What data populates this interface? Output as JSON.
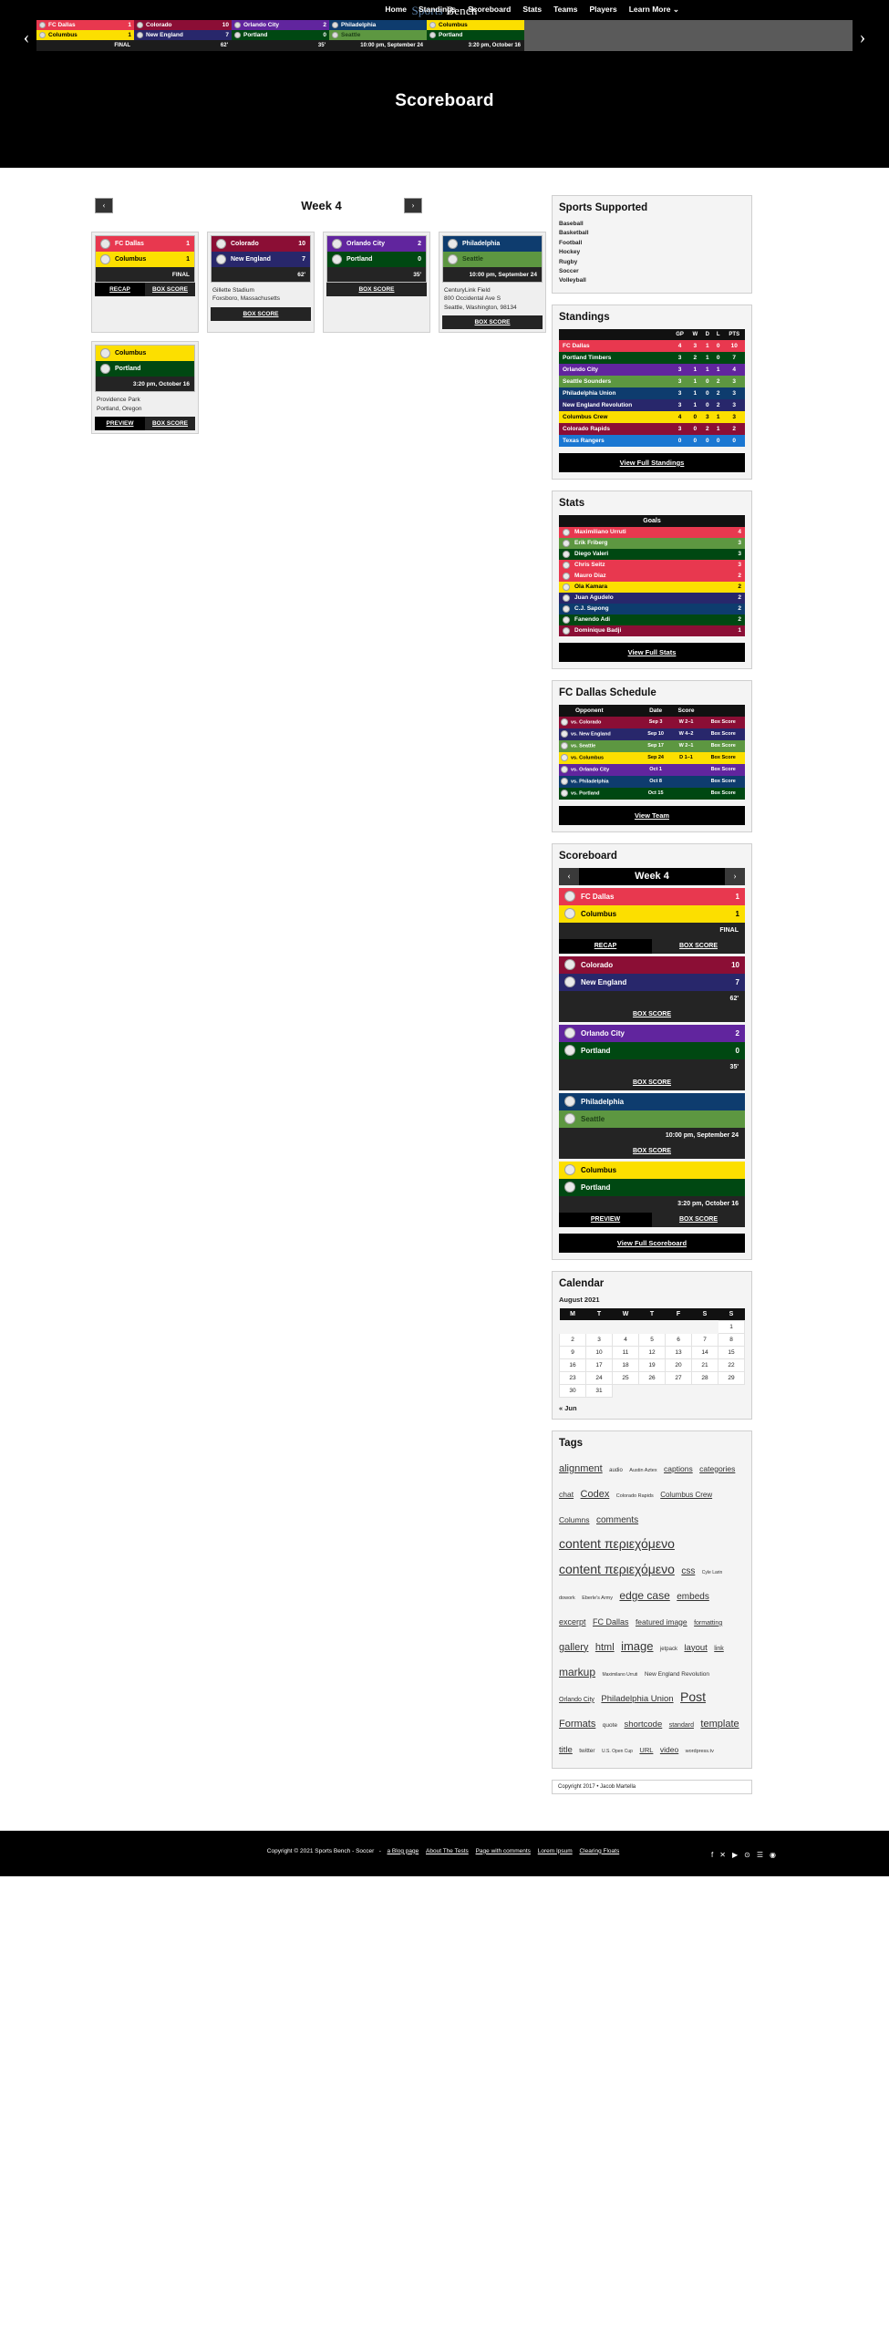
{
  "header": {
    "logo_sports": "Sports",
    "logo_bench": "Bench",
    "nav": [
      {
        "label": "Home"
      },
      {
        "label": "Standings"
      },
      {
        "label": "Scoreboard"
      },
      {
        "label": "Stats"
      },
      {
        "label": "Teams"
      },
      {
        "label": "Players"
      },
      {
        "label": "Learn More ⌄"
      }
    ]
  },
  "ticker": {
    "prev_icon": "‹",
    "next_icon": "›",
    "games": [
      {
        "away": {
          "name": "FC Dallas",
          "score": "1",
          "bg": "#e8384f",
          "fg": "#ffffff"
        },
        "home": {
          "name": "Columbus",
          "score": "1",
          "bg": "#fcdf00",
          "fg": "#000000"
        },
        "status": "FINAL"
      },
      {
        "away": {
          "name": "Colorado",
          "score": "10",
          "bg": "#8b0e35",
          "fg": "#ffffff"
        },
        "home": {
          "name": "New England",
          "score": "7",
          "bg": "#28276b",
          "fg": "#ffffff"
        },
        "status": "62'"
      },
      {
        "away": {
          "name": "Orlando City",
          "score": "2",
          "bg": "#61259e",
          "fg": "#ffffff"
        },
        "home": {
          "name": "Portland",
          "score": "0",
          "bg": "#004812",
          "fg": "#ffffff"
        },
        "status": "35'"
      },
      {
        "away": {
          "name": "Philadelphia",
          "score": "",
          "bg": "#0e3c6e",
          "fg": "#ffffff"
        },
        "home": {
          "name": "Seattle",
          "score": "",
          "bg": "#5d9741",
          "fg": "#1d3f17"
        },
        "status": "10:00 pm, September 24"
      },
      {
        "away": {
          "name": "Columbus",
          "score": "",
          "bg": "#fcdf00",
          "fg": "#000000"
        },
        "home": {
          "name": "Portland",
          "score": "",
          "bg": "#004812",
          "fg": "#ffffff"
        },
        "status": "3:20 pm, October 16"
      }
    ]
  },
  "hero": {
    "title": "Scoreboard"
  },
  "week_nav": {
    "prev": "‹",
    "next": "›",
    "title": "Week 4"
  },
  "games": [
    {
      "away": {
        "name": "FC Dallas",
        "score": "1",
        "bg": "#e8384f",
        "fg": "#ffffff"
      },
      "home": {
        "name": "Columbus",
        "score": "1",
        "bg": "#fcdf00",
        "fg": "#000000"
      },
      "status": "FINAL",
      "venue": "",
      "buttons": [
        "RECAP",
        "BOX SCORE"
      ]
    },
    {
      "away": {
        "name": "Colorado",
        "score": "10",
        "bg": "#8b0e35",
        "fg": "#ffffff"
      },
      "home": {
        "name": "New England",
        "score": "7",
        "bg": "#28276b",
        "fg": "#ffffff"
      },
      "status": "62'",
      "venue": "Gillette Stadium\nFoxsboro, Massachusetts",
      "buttons": [
        "BOX SCORE"
      ]
    },
    {
      "away": {
        "name": "Orlando City",
        "score": "2",
        "bg": "#61259e",
        "fg": "#ffffff"
      },
      "home": {
        "name": "Portland",
        "score": "0",
        "bg": "#004812",
        "fg": "#ffffff"
      },
      "status": "35'",
      "venue": "",
      "buttons": [
        "BOX SCORE"
      ]
    },
    {
      "away": {
        "name": "Philadelphia",
        "score": "",
        "bg": "#0e3c6e",
        "fg": "#ffffff"
      },
      "home": {
        "name": "Seattle",
        "score": "",
        "bg": "#5d9741",
        "fg": "#1d3f17"
      },
      "status": "10:00 pm, September 24",
      "venue": "CenturyLink Field\n800 Occidental Ave S\nSeattle, Washington, 98134",
      "buttons": [
        "BOX SCORE"
      ]
    },
    {
      "away": {
        "name": "Columbus",
        "score": "",
        "bg": "#fcdf00",
        "fg": "#000000"
      },
      "home": {
        "name": "Portland",
        "score": "",
        "bg": "#004812",
        "fg": "#ffffff"
      },
      "status": "3:20 pm, October 16",
      "venue": "Providence Park\nPortland, Oregon",
      "buttons": [
        "PREVIEW",
        "BOX SCORE"
      ]
    }
  ],
  "sports_supported": {
    "title": "Sports Supported",
    "items": [
      "Baseball",
      "Basketball",
      "Football",
      "Hockey",
      "Rugby",
      "Soccer",
      "Volleyball"
    ]
  },
  "standings": {
    "title": "Standings",
    "columns": [
      "",
      "GP",
      "W",
      "D",
      "L",
      "PTS"
    ],
    "rows": [
      {
        "team": "FC Dallas",
        "gp": "4",
        "w": "3",
        "d": "1",
        "l": "0",
        "pts": "10",
        "bg": "#e8384f"
      },
      {
        "team": "Portland Timbers",
        "gp": "3",
        "w": "2",
        "d": "1",
        "l": "0",
        "pts": "7",
        "bg": "#004812"
      },
      {
        "team": "Orlando City",
        "gp": "3",
        "w": "1",
        "d": "1",
        "l": "1",
        "pts": "4",
        "bg": "#61259e"
      },
      {
        "team": "Seattle Sounders",
        "gp": "3",
        "w": "1",
        "d": "0",
        "l": "2",
        "pts": "3",
        "bg": "#5d9741"
      },
      {
        "team": "Philadelphia Union",
        "gp": "3",
        "w": "1",
        "d": "0",
        "l": "2",
        "pts": "3",
        "bg": "#0e3c6e"
      },
      {
        "team": "New England Revolution",
        "gp": "3",
        "w": "1",
        "d": "0",
        "l": "2",
        "pts": "3",
        "bg": "#28276b"
      },
      {
        "team": "Columbus Crew",
        "gp": "4",
        "w": "0",
        "d": "3",
        "l": "1",
        "pts": "3",
        "bg": "#fcdf00",
        "fg": "#000000"
      },
      {
        "team": "Colorado Rapids",
        "gp": "3",
        "w": "0",
        "d": "2",
        "l": "1",
        "pts": "2",
        "bg": "#8b0e35"
      },
      {
        "team": "Texas Rangers",
        "gp": "0",
        "w": "0",
        "d": "0",
        "l": "0",
        "pts": "0",
        "bg": "#1a77d2"
      }
    ],
    "button": "View Full Standings"
  },
  "stats": {
    "title": "Stats",
    "subhead": "Goals",
    "rows": [
      {
        "player": "Maximiliano Urruti",
        "value": "4",
        "bg": "#e8384f"
      },
      {
        "player": "Erik Friberg",
        "value": "3",
        "bg": "#5d9741"
      },
      {
        "player": "Diego Valeri",
        "value": "3",
        "bg": "#004812"
      },
      {
        "player": "Chris Seitz",
        "value": "3",
        "bg": "#e8384f"
      },
      {
        "player": "Mauro Diaz",
        "value": "2",
        "bg": "#e8384f"
      },
      {
        "player": "Ola Kamara",
        "value": "2",
        "bg": "#fcdf00",
        "fg": "#000000"
      },
      {
        "player": "Juan Agudelo",
        "value": "2",
        "bg": "#28276b"
      },
      {
        "player": "C.J. Sapong",
        "value": "2",
        "bg": "#0e3c6e"
      },
      {
        "player": "Fanendo Adi",
        "value": "2",
        "bg": "#004812"
      },
      {
        "player": "Dominique Badji",
        "value": "1",
        "bg": "#8b0e35"
      }
    ],
    "button": "View Full Stats"
  },
  "schedule": {
    "title": "FC Dallas Schedule",
    "columns": [
      "Opponent",
      "Date",
      "Score",
      ""
    ],
    "rows": [
      {
        "opponent": "vs. Colorado",
        "date": "Sep 3",
        "score": "W 2–1",
        "link": "Box Score",
        "bg": "#8b0e35"
      },
      {
        "opponent": "vs. New England",
        "date": "Sep 10",
        "score": "W 4–2",
        "link": "Box Score",
        "bg": "#28276b"
      },
      {
        "opponent": "vs. Seattle",
        "date": "Sep 17",
        "score": "W 2–1",
        "link": "Box Score",
        "bg": "#5d9741"
      },
      {
        "opponent": "vs. Columbus",
        "date": "Sep 24",
        "score": "D 1–1",
        "link": "Box Score",
        "bg": "#fcdf00",
        "fg": "#000000"
      },
      {
        "opponent": "vs. Orlando City",
        "date": "Oct 1",
        "score": "",
        "link": "Box Score",
        "bg": "#61259e"
      },
      {
        "opponent": "vs. Philadelphia",
        "date": "Oct 8",
        "score": "",
        "link": "Box Score",
        "bg": "#0e3c6e"
      },
      {
        "opponent": "vs. Portland",
        "date": "Oct 15",
        "score": "",
        "link": "Box Score",
        "bg": "#004812"
      }
    ],
    "button": "View Team"
  },
  "sidebar_scoreboard": {
    "title": "Scoreboard",
    "nav": {
      "prev": "‹",
      "next": "›",
      "title": "Week 4"
    },
    "button": "View Full Scoreboard"
  },
  "calendar": {
    "title": "Calendar",
    "month": "August 2021",
    "day_headers": [
      "M",
      "T",
      "W",
      "T",
      "F",
      "S",
      "S"
    ],
    "weeks": [
      [
        "",
        "",
        "",
        "",
        "",
        "",
        "1"
      ],
      [
        "2",
        "3",
        "4",
        "5",
        "6",
        "7",
        "8"
      ],
      [
        "9",
        "10",
        "11",
        "12",
        "13",
        "14",
        "15"
      ],
      [
        "16",
        "17",
        "18",
        "19",
        "20",
        "21",
        "22"
      ],
      [
        "23",
        "24",
        "25",
        "26",
        "27",
        "28",
        "29"
      ],
      [
        "30",
        "31",
        "",
        "",
        "",
        "",
        ""
      ]
    ],
    "prev_link": "« Jun"
  },
  "tags": {
    "title": "Tags",
    "items": [
      {
        "label": "alignment",
        "size": 11
      },
      {
        "label": "audio",
        "size": 6
      },
      {
        "label": "Austin Aztex",
        "size": 5.5
      },
      {
        "label": "captions",
        "size": 8.5
      },
      {
        "label": "categories",
        "size": 8.5
      },
      {
        "label": "chat",
        "size": 8.5
      },
      {
        "label": "Codex",
        "size": 11
      },
      {
        "label": "Colorado Rapids",
        "size": 5.5
      },
      {
        "label": "Columbus Crew",
        "size": 8
      },
      {
        "label": "Columns",
        "size": 8.5
      },
      {
        "label": "comments",
        "size": 10
      },
      {
        "label": "content περιεχόμενο",
        "size": 14
      },
      {
        "label": "content περιεχόμενο",
        "size": 14
      },
      {
        "label": "css",
        "size": 10
      },
      {
        "label": "Cyle Larin",
        "size": 5
      },
      {
        "label": "dowork",
        "size": 5.5
      },
      {
        "label": "Eberle's Army",
        "size": 5.5
      },
      {
        "label": "edge case",
        "size": 12
      },
      {
        "label": "embeds",
        "size": 10
      },
      {
        "label": "excerpt",
        "size": 9
      },
      {
        "label": "FC Dallas",
        "size": 9
      },
      {
        "label": "featured image",
        "size": 8.5
      },
      {
        "label": "formatting",
        "size": 7
      },
      {
        "label": "gallery",
        "size": 11
      },
      {
        "label": "html",
        "size": 11
      },
      {
        "label": "image",
        "size": 13
      },
      {
        "label": "jetpack",
        "size": 6
      },
      {
        "label": "layout",
        "size": 9.5
      },
      {
        "label": "link",
        "size": 7
      },
      {
        "label": "markup",
        "size": 12
      },
      {
        "label": "Maximilano Urruti",
        "size": 5
      },
      {
        "label": "New England Revolution",
        "size": 6.5
      },
      {
        "label": "Orlando City",
        "size": 7
      },
      {
        "label": "Philadelphia Union",
        "size": 9.5
      },
      {
        "label": "Post",
        "size": 14
      },
      {
        "label": "Formats",
        "size": 11
      },
      {
        "label": "quote",
        "size": 6.5
      },
      {
        "label": "shortcode",
        "size": 9.5
      },
      {
        "label": "standard",
        "size": 7
      },
      {
        "label": "template",
        "size": 11
      },
      {
        "label": "title",
        "size": 9.5
      },
      {
        "label": "twitter",
        "size": 6.5
      },
      {
        "label": "U.S. Open Cup",
        "size": 5
      },
      {
        "label": "URL",
        "size": 7.5
      },
      {
        "label": "video",
        "size": 8.5
      },
      {
        "label": "wordpress.tv",
        "size": 5.5
      }
    ]
  },
  "credit": {
    "text": "Copyright 2017 • Jacob Martella"
  },
  "footer": {
    "copyright": "Copyright © 2021 Sports Bench - Soccer",
    "links": [
      "a Blog page",
      "About The Tests",
      "Page with comments",
      "Lorem Ipsum",
      "Clearing Floats"
    ],
    "social": [
      "",
      "",
      "",
      "",
      "",
      ""
    ]
  }
}
